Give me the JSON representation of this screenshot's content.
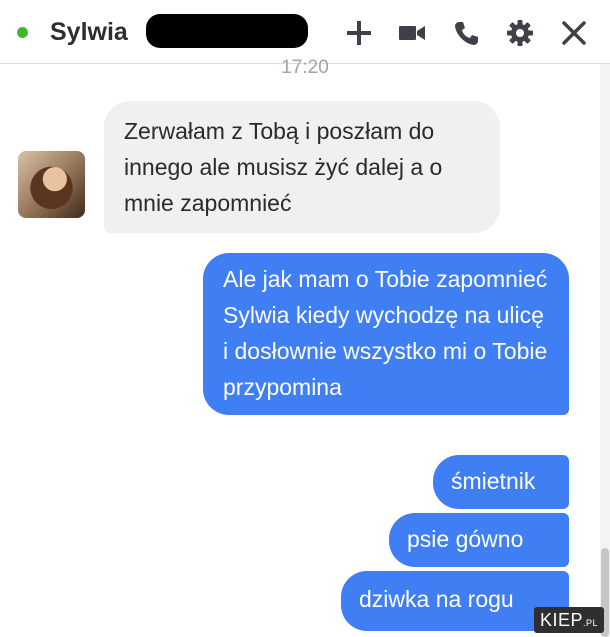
{
  "header": {
    "contact_name": "Sylwia",
    "icons": [
      "add-icon",
      "video-call-icon",
      "phone-icon",
      "gear-icon",
      "close-icon"
    ]
  },
  "conversation": {
    "timestamp": "17:20",
    "incoming": [
      {
        "text": "Zerwałam z Tobą i poszłam do innego ale musisz żyć dalej a o mnie zapomnieć"
      }
    ],
    "outgoing": [
      {
        "text": "Ale jak mam o Tobie zapomnieć Sylwia kiedy wychodzę na ulicę i dosłownie wszystko mi o Tobie przypomina"
      },
      {
        "text": "śmietnik"
      },
      {
        "text": "psie gówno"
      },
      {
        "text": "dziwka na rogu"
      }
    ]
  },
  "watermark": {
    "text": "KIEP",
    "suffix": ".PL"
  },
  "colors": {
    "online": "#42b72a",
    "outgoing_bubble": "#3f7ef3",
    "incoming_bubble": "#f1f0f0"
  }
}
